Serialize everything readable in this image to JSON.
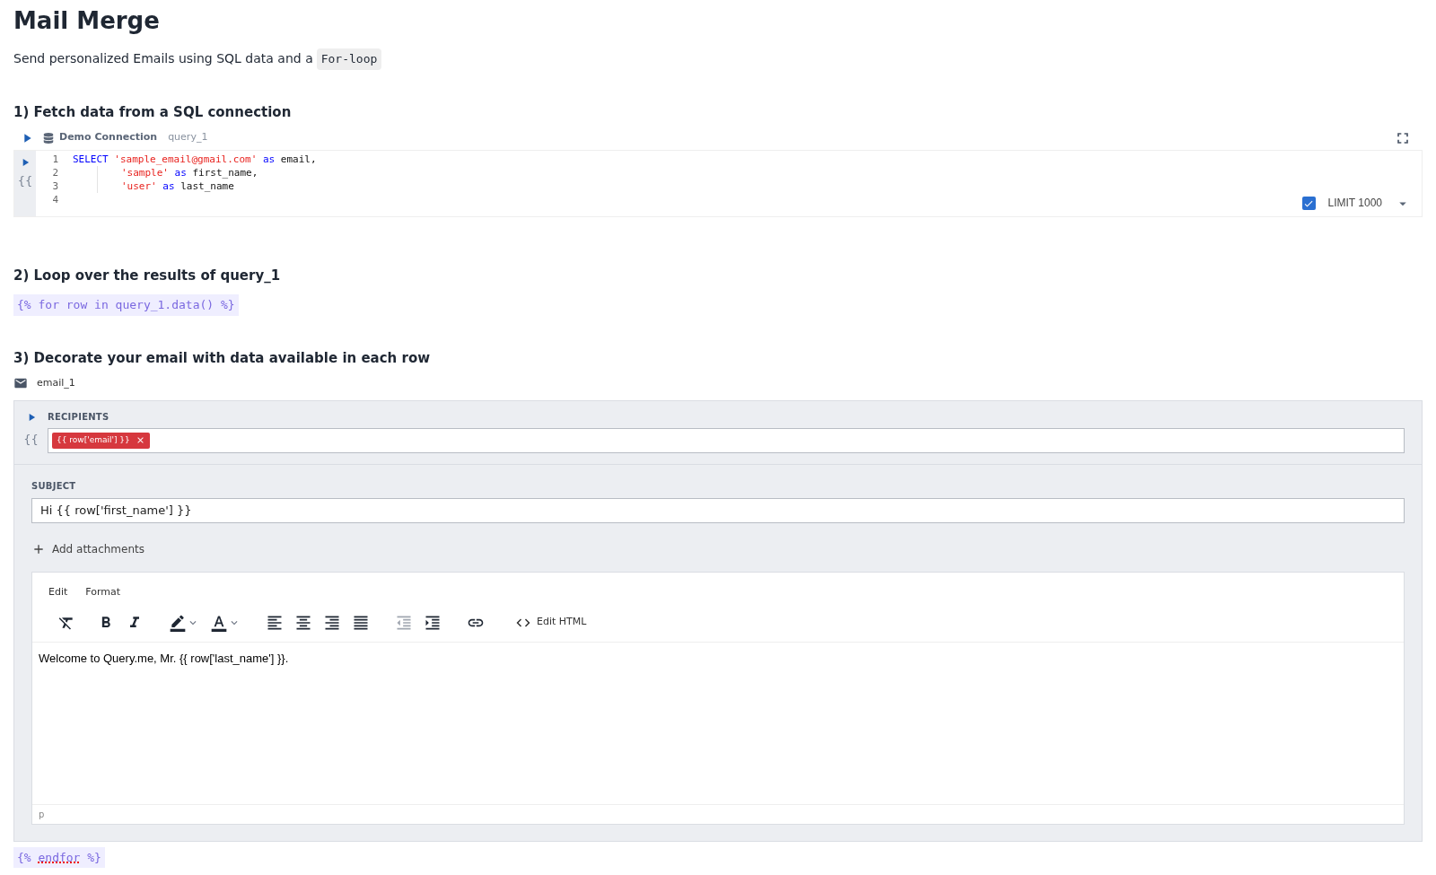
{
  "title": "Mail Merge",
  "subtitle": {
    "text": "Send personalized Emails using SQL data and a",
    "code": "For-loop"
  },
  "step1": {
    "heading": "1) Fetch data from a SQL connection",
    "connection": "Demo Connection",
    "query_name": "query_1",
    "gutter_label": "{{",
    "code_lines": [
      {
        "number": "1",
        "tokens": [
          {
            "kind": "keyword",
            "text": "SELECT "
          },
          {
            "kind": "string",
            "text": "'sample_email@gmail.com'"
          },
          {
            "kind": "keyword",
            "text": " as"
          },
          {
            "kind": "plain",
            "text": " email,"
          }
        ]
      },
      {
        "number": "2",
        "indent": true,
        "tokens": [
          {
            "kind": "string",
            "text": "'sample'"
          },
          {
            "kind": "keyword",
            "text": " as"
          },
          {
            "kind": "plain",
            "text": " first_name,"
          }
        ]
      },
      {
        "number": "3",
        "indent": true,
        "tokens": [
          {
            "kind": "string",
            "text": "'user'"
          },
          {
            "kind": "keyword",
            "text": " as"
          },
          {
            "kind": "plain",
            "text": " last_name"
          }
        ]
      },
      {
        "number": "4"
      }
    ],
    "limit": {
      "label": "LIMIT 1000",
      "checked": true
    }
  },
  "step2": {
    "heading": "2) Loop over the results of query_1",
    "tag": "{% for row in query_1.data() %}"
  },
  "step3": {
    "heading": "3) Decorate your email with data available in each row",
    "block_name": "email_1",
    "recipients": {
      "label": "RECIPIENTS",
      "gutter_label": "{{",
      "chips": [
        "{{ row['email'] }}"
      ]
    },
    "subject": {
      "label": "SUBJECT",
      "value": "Hi {{ row['first_name'] }}"
    },
    "add_attachments": "Add attachments",
    "editor": {
      "menus": [
        "Edit",
        "Format"
      ],
      "toolbar": [
        {
          "kind": "clear",
          "disabled": false
        },
        {
          "kind": "bold",
          "disabled": false
        },
        {
          "kind": "italic",
          "disabled": false
        },
        {
          "kind": "highlight",
          "disabled": false
        },
        {
          "kind": "textcolor",
          "disabled": false
        },
        {
          "kind": "alignleft",
          "disabled": false
        },
        {
          "kind": "aligncenter",
          "disabled": false
        },
        {
          "kind": "alignright",
          "disabled": false
        },
        {
          "kind": "justify",
          "disabled": false
        },
        {
          "kind": "outdent",
          "disabled": true
        },
        {
          "kind": "indent",
          "disabled": false
        },
        {
          "kind": "link",
          "disabled": false
        }
      ],
      "edit_html": "Edit HTML",
      "body": "Welcome to Query.me, Mr. {{ row['last_name'] }}.",
      "status": "p"
    }
  },
  "end_tag": {
    "before": "{% ",
    "word": "endfor",
    "after": " %}"
  }
}
